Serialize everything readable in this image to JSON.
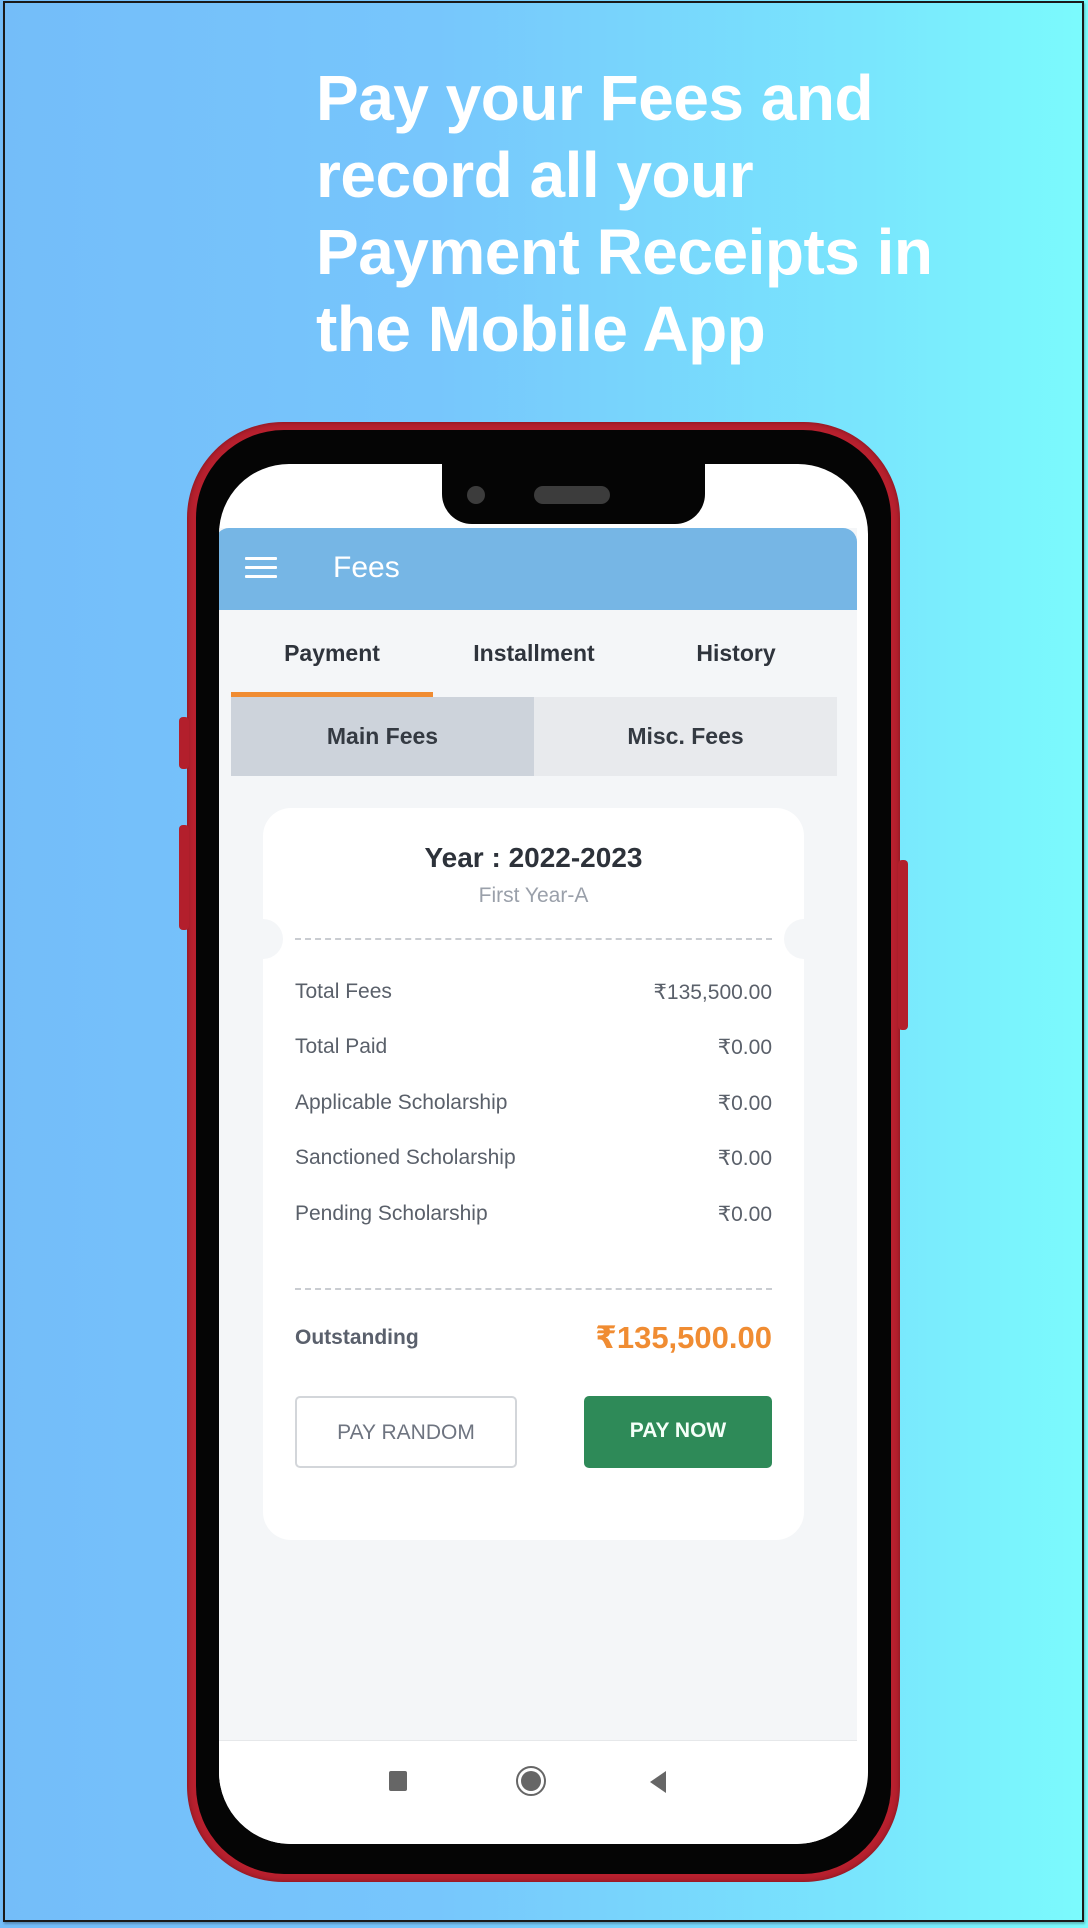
{
  "headline": {
    "lines": [
      "Pay your Fees and",
      "record all your",
      "Payment Receipts in",
      "the Mobile App"
    ]
  },
  "appbar": {
    "menu_icon": "hamburger-menu-icon",
    "title": "Fees"
  },
  "tabs": [
    {
      "label": "Payment",
      "active": true
    },
    {
      "label": "Installment",
      "active": false
    },
    {
      "label": "History",
      "active": false
    }
  ],
  "subtabs": [
    {
      "label": "Main Fees",
      "active": true
    },
    {
      "label": "Misc. Fees",
      "active": false
    }
  ],
  "card": {
    "year": "Year : 2022-2023",
    "program": "First Year-A",
    "rows": [
      {
        "label": "Total Fees",
        "value": "₹135,500.00"
      },
      {
        "label": "Total Paid",
        "value": "₹0.00"
      },
      {
        "label": "Applicable Scholarship",
        "value": "₹0.00"
      },
      {
        "label": "Sanctioned Scholarship",
        "value": "₹0.00"
      },
      {
        "label": "Pending Scholarship",
        "value": "₹0.00"
      }
    ],
    "outstanding_label": "Outstanding",
    "outstanding_value": "₹135,500.00",
    "pay_random_label": "PAY RANDOM",
    "pay_now_label": "PAY NOW"
  },
  "navbar": {
    "recent_icon": "recent-apps-icon",
    "home_icon": "home-icon",
    "back_icon": "back-icon"
  },
  "colors": {
    "accent": "#F08C32",
    "appbar": "#76B6E5",
    "pay_now": "#2E8A58",
    "phone_frame": "#B8202E"
  }
}
